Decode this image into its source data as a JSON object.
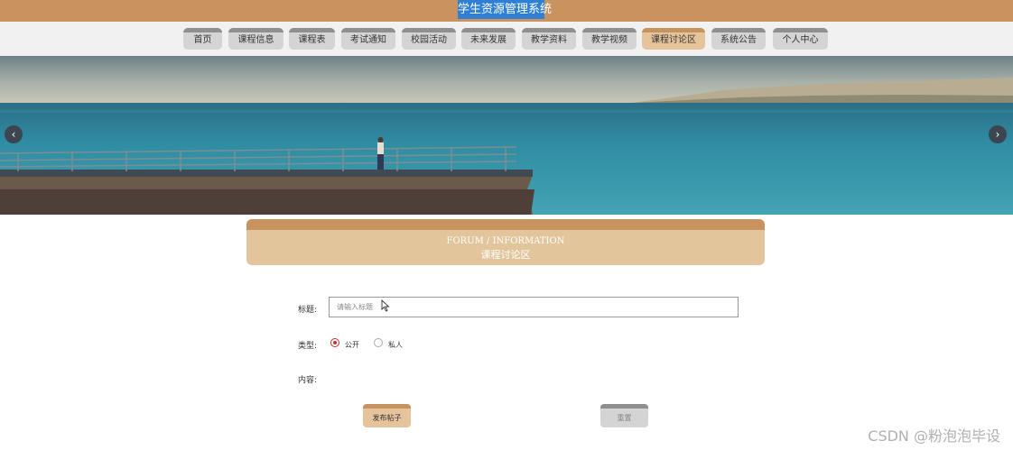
{
  "header": {
    "title": "学生资源管理系统"
  },
  "nav": {
    "items": [
      {
        "label": "首页",
        "active": false
      },
      {
        "label": "课程信息",
        "active": false
      },
      {
        "label": "课程表",
        "active": false
      },
      {
        "label": "考试通知",
        "active": false
      },
      {
        "label": "校园活动",
        "active": false
      },
      {
        "label": "未来发展",
        "active": false
      },
      {
        "label": "教学资料",
        "active": false
      },
      {
        "label": "教学视频",
        "active": false
      },
      {
        "label": "课程讨论区",
        "active": true
      },
      {
        "label": "系统公告",
        "active": false
      },
      {
        "label": "个人中心",
        "active": false
      }
    ]
  },
  "banner": {
    "prev_icon": "chevron-left-icon",
    "next_icon": "chevron-right-icon",
    "prev_glyph": "‹",
    "next_glyph": "›"
  },
  "section": {
    "title_en": "FORUM / INFORMATION",
    "title_cn": "课程讨论区"
  },
  "form": {
    "title_label": "标题:",
    "title_placeholder": "请输入标题",
    "title_value": "",
    "type_label": "类型:",
    "type_options": [
      {
        "label": "公开",
        "checked": true
      },
      {
        "label": "私人",
        "checked": false
      }
    ],
    "content_label": "内容:",
    "submit_label": "发布帖子",
    "reset_label": "重置"
  },
  "watermark": "CSDN @粉泡泡毕设",
  "colors": {
    "brand": "#c99360",
    "title_bg": "#2f7fd6",
    "active_tab": "#e6c49b",
    "radio_checked": "#c4332b"
  }
}
